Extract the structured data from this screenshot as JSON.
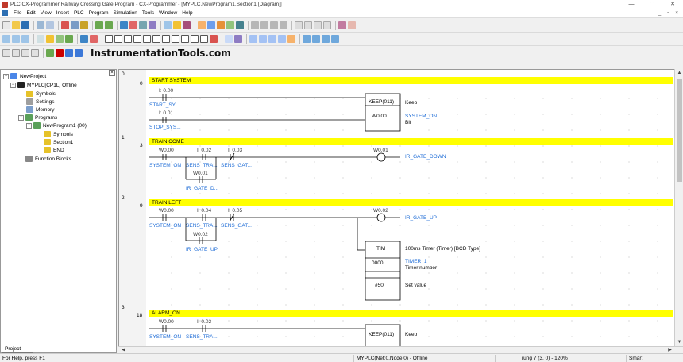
{
  "window": {
    "title": "PLC CX-Programmer Railway Crossing Gate Program - CX-Programmer - [MYPLC.NewProgram1.Section1 [Diagram]]",
    "minimize": "—",
    "maximize": "▢",
    "close": "✕",
    "mdi_controls": "_ ▫ ×"
  },
  "menu": [
    "File",
    "Edit",
    "View",
    "Insert",
    "PLC",
    "Program",
    "Simulation",
    "Tools",
    "Window",
    "Help"
  ],
  "brand": "InstrumentationTools.com",
  "tree": {
    "root": "NewProject",
    "plc": "MYPLC[CP1L] Offline",
    "symbols": "Symbols",
    "settings": "Settings",
    "memory": "Memory",
    "programs": "Programs",
    "program1": "NewProgram1 (00)",
    "p_symbols": "Symbols",
    "section1": "Section1",
    "end": "END",
    "function_blocks": "Function Blocks"
  },
  "project_tab": "Project",
  "rungs": [
    {
      "index": "0",
      "step": "0",
      "title": "START SYSTEM",
      "c1_addr": "I: 0.00",
      "c1_sym": "START_SY...",
      "c2_addr": "I: 0.01",
      "c2_sym": "STOP_SYS...",
      "box": "KEEP(011)",
      "box_operand": "W0.00",
      "box_comment": "Keep",
      "out_sym": "SYSTEM_ON",
      "out_note": "Bit"
    },
    {
      "index": "1",
      "step": "3",
      "title": "TRAIN COME",
      "c1_addr": "W0.00",
      "c1_sym": "SYSTEM_ON",
      "c2_addr": "I: 0.02",
      "c2_sym": "SENS_TRAI...",
      "c3_addr": "I: 0.03",
      "c3_sym": "SENS_GAT...",
      "c4_addr": "W0.01",
      "c4_sym": "IR_GATE_D...",
      "coil_addr": "W0.01",
      "coil_sym": "IR_GATE_DOWN"
    },
    {
      "index": "2",
      "step": "9",
      "title": "TRAIN LEFT",
      "c1_addr": "W0.00",
      "c1_sym": "SYSTEM_ON",
      "c2_addr": "I: 0.04",
      "c2_sym": "SENS_TRAI...",
      "c3_addr": "I: 0.05",
      "c3_sym": "SENS_GAT...",
      "c4_addr": "W0.02",
      "c4_sym": "IR_GATE_UP",
      "coil_addr": "W0.02",
      "coil_sym": "IR_GATE_UP",
      "timer_box": "TIM",
      "timer_num": "0000",
      "timer_set": "#50",
      "timer_comment": "100ms Timer (Timer) [BCD Type]",
      "timer_sym": "TIMER_1",
      "timer_num_label": "Timer number",
      "timer_set_label": "Set value"
    },
    {
      "index": "3",
      "step": "18",
      "title": "ALARM_ON",
      "c1_addr": "W0.00",
      "c1_sym": "SYSTEM_ON",
      "c2_addr": "I: 0.02",
      "c2_sym": "SENS_TRAI...",
      "box": "KEEP(011)",
      "box_comment": "Keep"
    }
  ],
  "status": {
    "help": "For Help, press F1",
    "plc": "MYPLC(Net:0,Node:0) - Offline",
    "rung": "rung 7 (3, 0)  - 120%",
    "mode": "Smart"
  },
  "colors": {
    "rung_header": "#ffff00",
    "symbol_text": "#1c6bd6",
    "title_icon": "#c0392b"
  }
}
